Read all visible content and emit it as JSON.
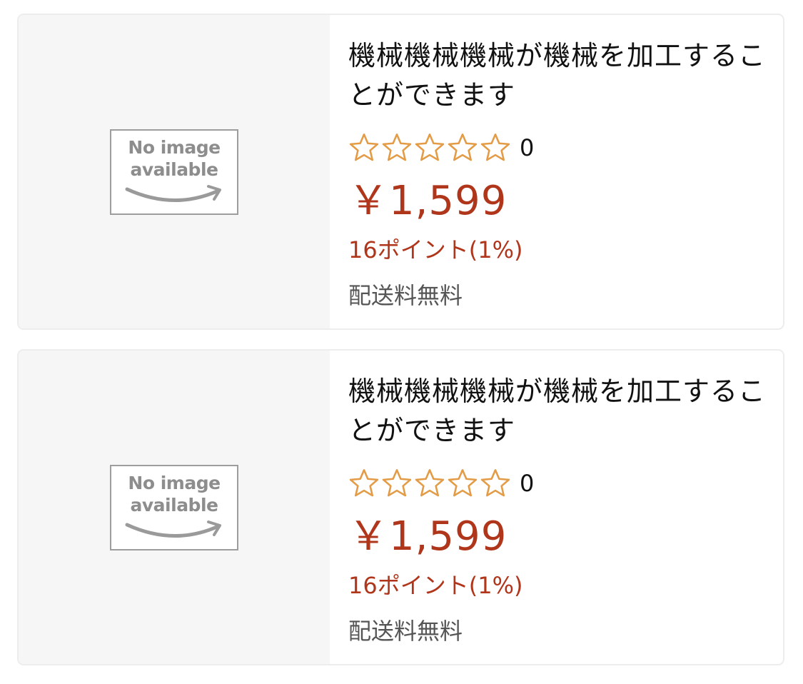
{
  "products": [
    {
      "image_placeholder": "No image\navailable",
      "title": "機械機械機械が機械を加工することができます",
      "rating": {
        "stars": 0,
        "count": "0"
      },
      "price": "￥1,599",
      "points": "16ポイント(1%)",
      "shipping": "配送料無料"
    },
    {
      "image_placeholder": "No image\navailable",
      "title": "機械機械機械が機械を加工することができます",
      "rating": {
        "stars": 0,
        "count": "0"
      },
      "price": "￥1,599",
      "points": "16ポイント(1%)",
      "shipping": "配送料無料"
    }
  ],
  "colors": {
    "price": "#b0361b",
    "star_outline": "#e39b46",
    "thumb_bg": "#f6f6f6"
  },
  "icons": {
    "star": "star-outline-icon",
    "placeholder": "amazon-smile-arrow"
  }
}
